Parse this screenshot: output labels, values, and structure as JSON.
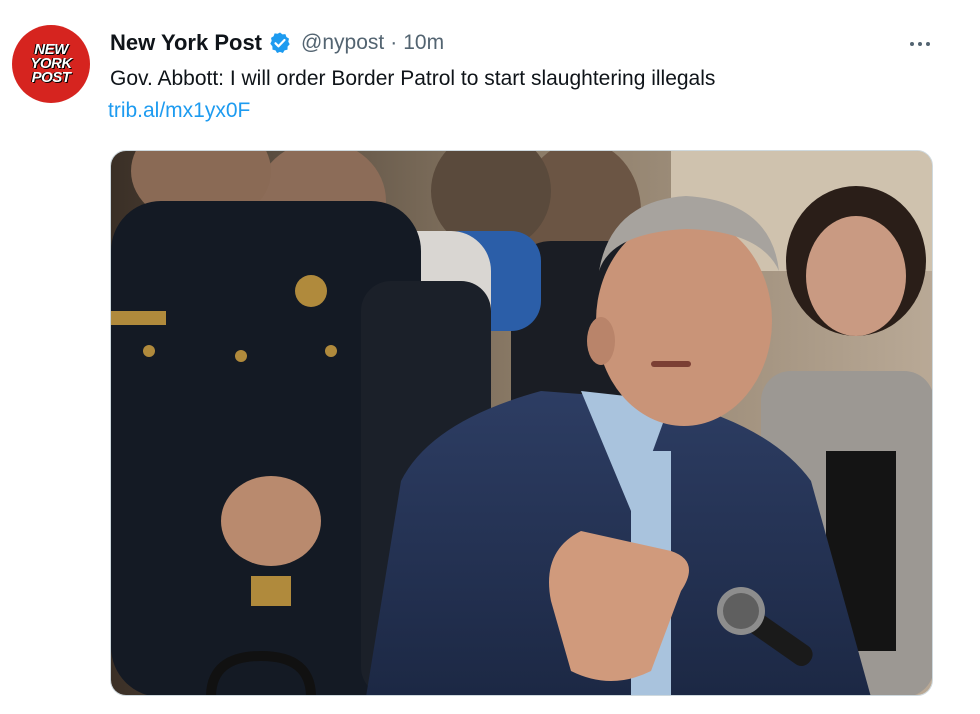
{
  "tweet": {
    "author_name": "New York Post",
    "author_handle": "@nypost",
    "separator": "·",
    "timestamp": "10m",
    "text": "Gov. Abbott: I will order Border Patrol to start slaughtering illegals",
    "link": "trib.al/mx1yx0F",
    "verified": true
  },
  "avatar": {
    "line1": "NEW",
    "line2": "YORK",
    "line3": "POST",
    "color": "#d6241f"
  },
  "icons": {
    "verified": "verified-badge-icon",
    "more": "more-options-icon"
  },
  "colors": {
    "link": "#1d9bf0",
    "secondary": "#536471",
    "verified": "#1d9bf0"
  }
}
